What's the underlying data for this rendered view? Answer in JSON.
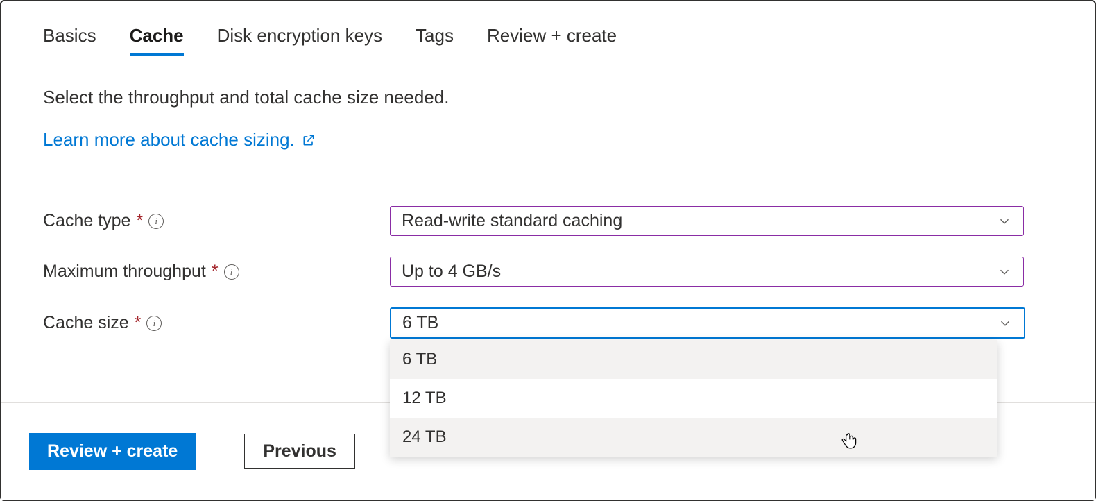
{
  "tabs": {
    "basics": "Basics",
    "cache": "Cache",
    "disk_encryption": "Disk encryption keys",
    "tags": "Tags",
    "review": "Review + create"
  },
  "description": "Select the throughput and total cache size needed.",
  "learn_more": "Learn more about cache sizing.",
  "form": {
    "cache_type": {
      "label": "Cache type",
      "value": "Read-write standard caching"
    },
    "max_throughput": {
      "label": "Maximum throughput",
      "value": "Up to 4 GB/s"
    },
    "cache_size": {
      "label": "Cache size",
      "value": "6 TB",
      "options": [
        "6 TB",
        "12 TB",
        "24 TB"
      ]
    }
  },
  "footer": {
    "review_create": "Review + create",
    "previous": "Previous"
  }
}
